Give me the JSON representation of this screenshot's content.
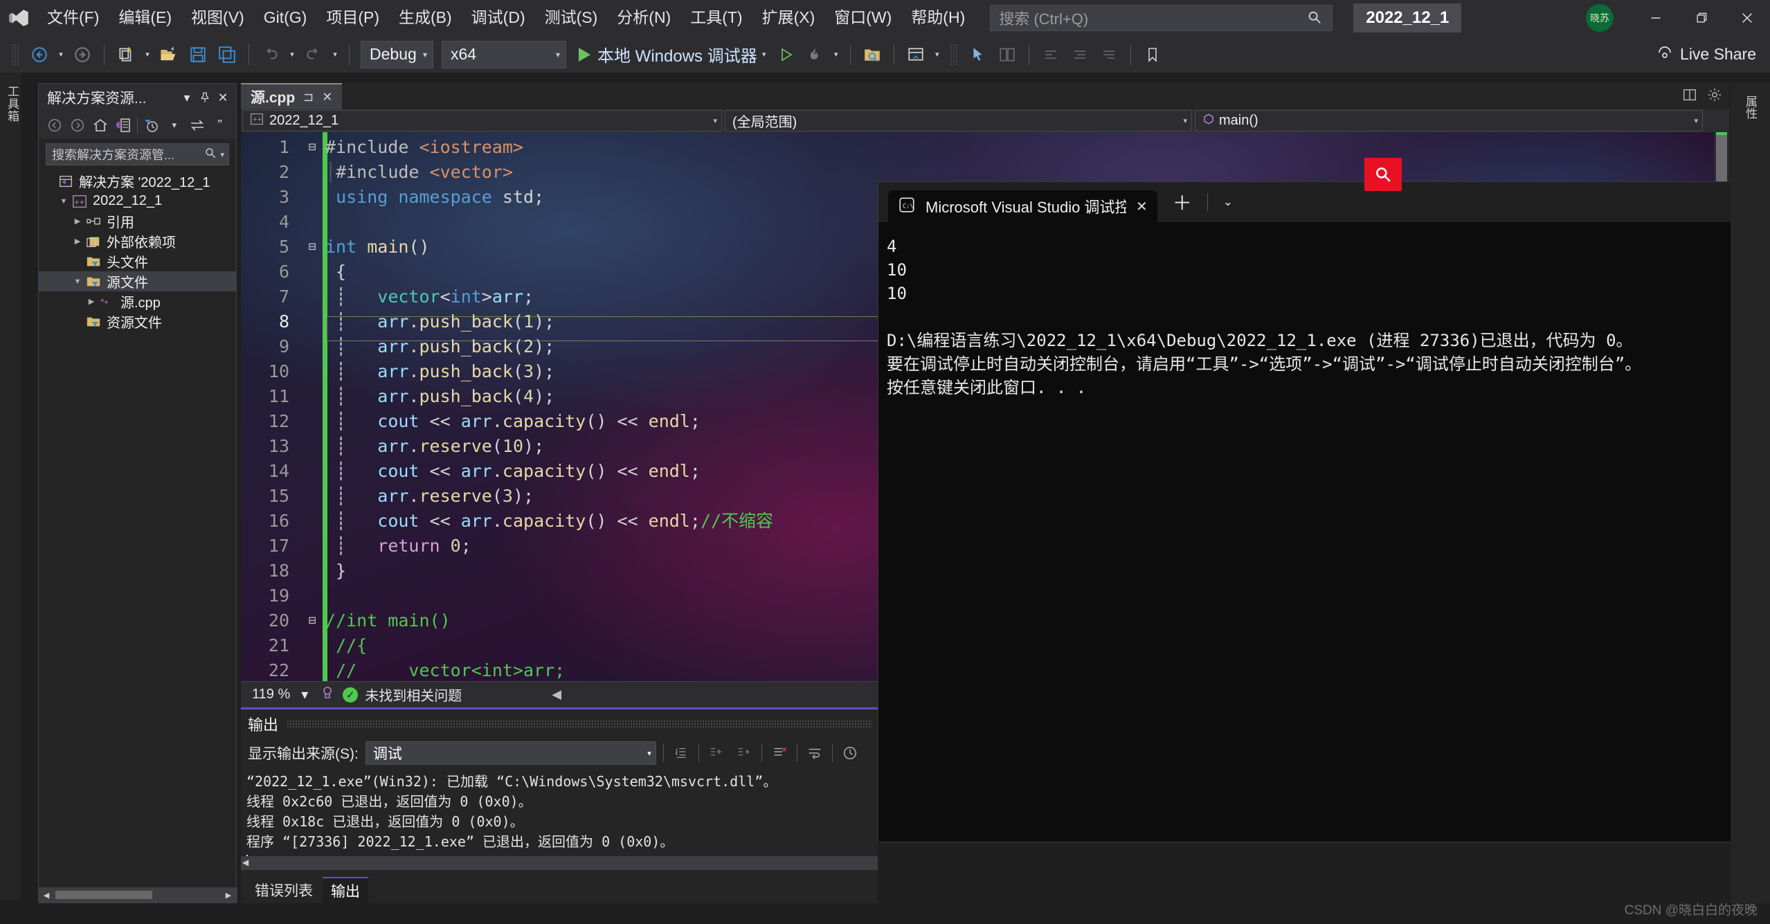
{
  "window": {
    "project_chip": "2022_12_1",
    "avatar_initials": "晓苏",
    "minimize": "—",
    "maximize": "❐",
    "close": "✕"
  },
  "menubar": {
    "logo_icon": "visual-studio-logo-icon",
    "items": [
      "文件(F)",
      "编辑(E)",
      "视图(V)",
      "Git(G)",
      "项目(P)",
      "生成(B)",
      "调试(D)",
      "测试(S)",
      "分析(N)",
      "工具(T)",
      "扩展(X)",
      "窗口(W)",
      "帮助(H)"
    ],
    "search_placeholder": "搜索 (Ctrl+Q)",
    "search_icon": "search-icon"
  },
  "toolbar": {
    "nav_back_icon": "arrow-back-icon",
    "nav_forward_icon": "arrow-forward-icon",
    "new_item_icon": "new-item-icon",
    "open_icon": "open-folder-icon",
    "save_icon": "save-icon",
    "save_all_icon": "save-all-icon",
    "undo_icon": "undo-icon",
    "redo_icon": "redo-icon",
    "configuration": "Debug",
    "platform": "x64",
    "run_label": "本地 Windows 调试器",
    "run_icon": "play-icon",
    "attach_icon": "play-outline-icon",
    "hot_reload_icon": "flame-icon",
    "folder_search_icon": "folder-search-icon",
    "window_layout_icon": "window-layout-icon",
    "select_icon": "pointer-icon",
    "compare_icon": "compare-icon",
    "align_icons": [
      "align-1-icon",
      "align-2-icon",
      "align-3-icon"
    ],
    "bookmark_icon": "bookmark-icon",
    "live_share": "Live Share",
    "live_share_icon": "live-share-icon"
  },
  "left_edge": {
    "vertical_tabs": [
      "工具箱"
    ]
  },
  "right_edge": {
    "vertical_tabs": [
      "属性"
    ]
  },
  "solution_explorer": {
    "title": "解决方案资源...",
    "dropdown_icon": "chevron-down-icon",
    "pin_icon": "pin-icon",
    "close_icon": "close-icon",
    "toolbar_icons": [
      "arrow-back-icon",
      "arrow-forward-icon",
      "home-icon",
      "solution-explorer-icon",
      "pending-changes-icon",
      "chevron-down-icon",
      "sync-icon",
      "collapse-all-icon"
    ],
    "search_placeholder": "搜索解决方案资源管...",
    "search_icon": "search-icon",
    "search_dropdown_icon": "chevron-down-icon",
    "tree": [
      {
        "label": "解决方案 '2022_12_1",
        "icon": "solution-icon",
        "indent": 0,
        "expander": "",
        "selected": false
      },
      {
        "label": "2022_12_1",
        "icon": "cpp-project-icon",
        "indent": 1,
        "expander": "▼",
        "selected": false
      },
      {
        "label": "引用",
        "icon": "references-icon",
        "indent": 2,
        "expander": "▶",
        "selected": false
      },
      {
        "label": "外部依赖项",
        "icon": "external-deps-icon",
        "indent": 2,
        "expander": "▶",
        "selected": false
      },
      {
        "label": "头文件",
        "icon": "filter-folder-icon",
        "indent": 2,
        "expander": "",
        "selected": false
      },
      {
        "label": "源文件",
        "icon": "filter-folder-icon",
        "indent": 2,
        "expander": "▼",
        "selected": true
      },
      {
        "label": "源.cpp",
        "icon": "cpp-file-icon",
        "indent": 3,
        "expander": "▶",
        "selected": false
      },
      {
        "label": "资源文件",
        "icon": "filter-folder-icon",
        "indent": 2,
        "expander": "",
        "selected": false
      }
    ]
  },
  "editor": {
    "tab_name": "源.cpp",
    "tab_pin_icon": "pin-icon",
    "tab_close_icon": "close-icon",
    "navbar": {
      "project": "2022_12_1",
      "project_icon": "cpp-project-icon",
      "scope": "(全局范围)",
      "member": "main()",
      "member_icon": "method-icon",
      "dropdown_icon": "chevron-down-icon"
    },
    "current_line": 8,
    "lines": [
      {
        "n": 1,
        "glyph": "⊟",
        "tokens": [
          [
            "pp",
            "#include "
          ],
          [
            "str",
            "<iostream>"
          ]
        ]
      },
      {
        "n": 2,
        "glyph": "",
        "tokens": [
          [
            "ind",
            "│"
          ],
          [
            "pp",
            "#include "
          ],
          [
            "str",
            "<vector>"
          ]
        ]
      },
      {
        "n": 3,
        "glyph": "",
        "tokens": [
          [
            "pl",
            " "
          ],
          [
            "k",
            "using namespace "
          ],
          [
            "pl",
            "std;"
          ]
        ]
      },
      {
        "n": 4,
        "glyph": "",
        "tokens": []
      },
      {
        "n": 5,
        "glyph": "⊟",
        "tokens": [
          [
            "k",
            "int "
          ],
          [
            "fn",
            "main"
          ],
          [
            "pl",
            "()"
          ]
        ]
      },
      {
        "n": 6,
        "glyph": "",
        "tokens": [
          [
            "pl",
            " {"
          ]
        ]
      },
      {
        "n": 7,
        "glyph": "",
        "tokens": [
          [
            "pl",
            " ┊   "
          ],
          [
            "ty",
            "vector"
          ],
          [
            "pl",
            "<"
          ],
          [
            "k",
            "int"
          ],
          [
            "pl",
            ">"
          ],
          [
            "id",
            "arr"
          ],
          [
            "pl",
            ";"
          ]
        ]
      },
      {
        "n": 8,
        "glyph": "",
        "tokens": [
          [
            "pl",
            " ┊   "
          ],
          [
            "id",
            "arr"
          ],
          [
            "pl",
            "."
          ],
          [
            "fn",
            "push_back"
          ],
          [
            "pl",
            "("
          ],
          [
            "nu",
            "1"
          ],
          [
            "pl",
            ");"
          ]
        ]
      },
      {
        "n": 9,
        "glyph": "",
        "tokens": [
          [
            "pl",
            " ┊   "
          ],
          [
            "id",
            "arr"
          ],
          [
            "pl",
            "."
          ],
          [
            "fn",
            "push_back"
          ],
          [
            "pl",
            "("
          ],
          [
            "nu",
            "2"
          ],
          [
            "pl",
            ");"
          ]
        ]
      },
      {
        "n": 10,
        "glyph": "",
        "tokens": [
          [
            "pl",
            " ┊   "
          ],
          [
            "id",
            "arr"
          ],
          [
            "pl",
            "."
          ],
          [
            "fn",
            "push_back"
          ],
          [
            "pl",
            "("
          ],
          [
            "nu",
            "3"
          ],
          [
            "pl",
            ");"
          ]
        ]
      },
      {
        "n": 11,
        "glyph": "",
        "tokens": [
          [
            "pl",
            " ┊   "
          ],
          [
            "id",
            "arr"
          ],
          [
            "pl",
            "."
          ],
          [
            "fn",
            "push_back"
          ],
          [
            "pl",
            "("
          ],
          [
            "nu",
            "4"
          ],
          [
            "pl",
            ");"
          ]
        ]
      },
      {
        "n": 12,
        "glyph": "",
        "tokens": [
          [
            "pl",
            " ┊   "
          ],
          [
            "id",
            "cout"
          ],
          [
            "pl",
            " << "
          ],
          [
            "id",
            "arr"
          ],
          [
            "pl",
            "."
          ],
          [
            "fn",
            "capacity"
          ],
          [
            "pl",
            "() << "
          ],
          [
            "fn",
            "endl"
          ],
          [
            "pl",
            ";"
          ]
        ]
      },
      {
        "n": 13,
        "glyph": "",
        "tokens": [
          [
            "pl",
            " ┊   "
          ],
          [
            "id",
            "arr"
          ],
          [
            "pl",
            "."
          ],
          [
            "fn",
            "reserve"
          ],
          [
            "pl",
            "("
          ],
          [
            "nu",
            "10"
          ],
          [
            "pl",
            ");"
          ]
        ]
      },
      {
        "n": 14,
        "glyph": "",
        "tokens": [
          [
            "pl",
            " ┊   "
          ],
          [
            "id",
            "cout"
          ],
          [
            "pl",
            " << "
          ],
          [
            "id",
            "arr"
          ],
          [
            "pl",
            "."
          ],
          [
            "fn",
            "capacity"
          ],
          [
            "pl",
            "() << "
          ],
          [
            "fn",
            "endl"
          ],
          [
            "pl",
            ";"
          ]
        ]
      },
      {
        "n": 15,
        "glyph": "",
        "tokens": [
          [
            "pl",
            " ┊   "
          ],
          [
            "id",
            "arr"
          ],
          [
            "pl",
            "."
          ],
          [
            "fn",
            "reserve"
          ],
          [
            "pl",
            "("
          ],
          [
            "nu",
            "3"
          ],
          [
            "pl",
            ");"
          ]
        ]
      },
      {
        "n": 16,
        "glyph": "",
        "tokens": [
          [
            "pl",
            " ┊   "
          ],
          [
            "id",
            "cout"
          ],
          [
            "pl",
            " << "
          ],
          [
            "id",
            "arr"
          ],
          [
            "pl",
            "."
          ],
          [
            "fn",
            "capacity"
          ],
          [
            "pl",
            "() << "
          ],
          [
            "fn",
            "endl"
          ],
          [
            "pl",
            ";"
          ],
          [
            "cm",
            "//不缩容"
          ]
        ]
      },
      {
        "n": 17,
        "glyph": "",
        "tokens": [
          [
            "pl",
            " ┊   "
          ],
          [
            "ctl",
            "return "
          ],
          [
            "nu",
            "0"
          ],
          [
            "pl",
            ";"
          ]
        ]
      },
      {
        "n": 18,
        "glyph": "",
        "tokens": [
          [
            "pl",
            " }"
          ]
        ]
      },
      {
        "n": 19,
        "glyph": "",
        "tokens": []
      },
      {
        "n": 20,
        "glyph": "⊟",
        "tokens": [
          [
            "cm",
            "//int main()"
          ]
        ]
      },
      {
        "n": 21,
        "glyph": "",
        "tokens": [
          [
            "pl",
            " "
          ],
          [
            "cm",
            "//{"
          ]
        ]
      },
      {
        "n": 22,
        "glyph": "",
        "tokens": [
          [
            "pl",
            " "
          ],
          [
            "cm",
            "//\tvector<int>arr;"
          ]
        ]
      }
    ],
    "statusbar": {
      "zoom": "119 %",
      "zoom_caret": "▾",
      "intellicode_icon": "intellicode-icon",
      "issues_icon": "check-circle-icon",
      "issues_text": "未找到相关问题",
      "scroll_left_icon": "scroll-left-icon"
    }
  },
  "output_panel": {
    "title": "输出",
    "source_label": "显示输出来源(S):",
    "source_value": "调试",
    "source_caret": "▾",
    "toolbar_icons": [
      "find-message-icon",
      "go-previous-icon",
      "go-next-icon",
      "clear-all-icon",
      "word-wrap-icon",
      "toggle-timestamp-icon"
    ],
    "lines": [
      "“2022_12_1.exe”(Win32): 已加载 “C:\\Windows\\System32\\msvcrt.dll”。",
      "线程 0x2c60 已退出，返回值为 0 (0x0)。",
      "线程 0x18c 已退出，返回值为 0 (0x0)。",
      "程序 “[27336] 2022_12_1.exe” 已退出，返回值为 0 (0x0)。"
    ],
    "tabs": [
      {
        "label": "错误列表",
        "active": false
      },
      {
        "label": "输出",
        "active": true
      }
    ],
    "scroll_left_icon": "scroll-left-icon"
  },
  "console_window": {
    "tab_icon": "cmd-icon",
    "tab_title": "Microsoft Visual Studio 调试控",
    "tab_close_icon": "close-icon",
    "new_tab_icon": "plus-icon",
    "dropdown_icon": "chevron-down-icon",
    "lines": [
      "4",
      "10",
      "10",
      "",
      "D:\\编程语言练习\\2022_12_1\\x64\\Debug\\2022_12_1.exe (进程 27336)已退出，代码为 0。",
      "要在调试停止时自动关闭控制台，请启用“工具”->“选项”->“调试”->“调试停止时自动关闭控制台”。",
      "按任意键关闭此窗口. . ."
    ]
  },
  "floating_search_button": {
    "icon": "search-icon",
    "color": "#e81123"
  },
  "watermark": "CSDN @晓白白的夜晚",
  "colors": {
    "accent_purple": "#6a4bc4",
    "change_bar_green": "#4ec94e",
    "menu_bg": "#2d2d30",
    "panel_bg": "#252526",
    "console_bg": "#0c0c0c",
    "red_button": "#e81123"
  }
}
